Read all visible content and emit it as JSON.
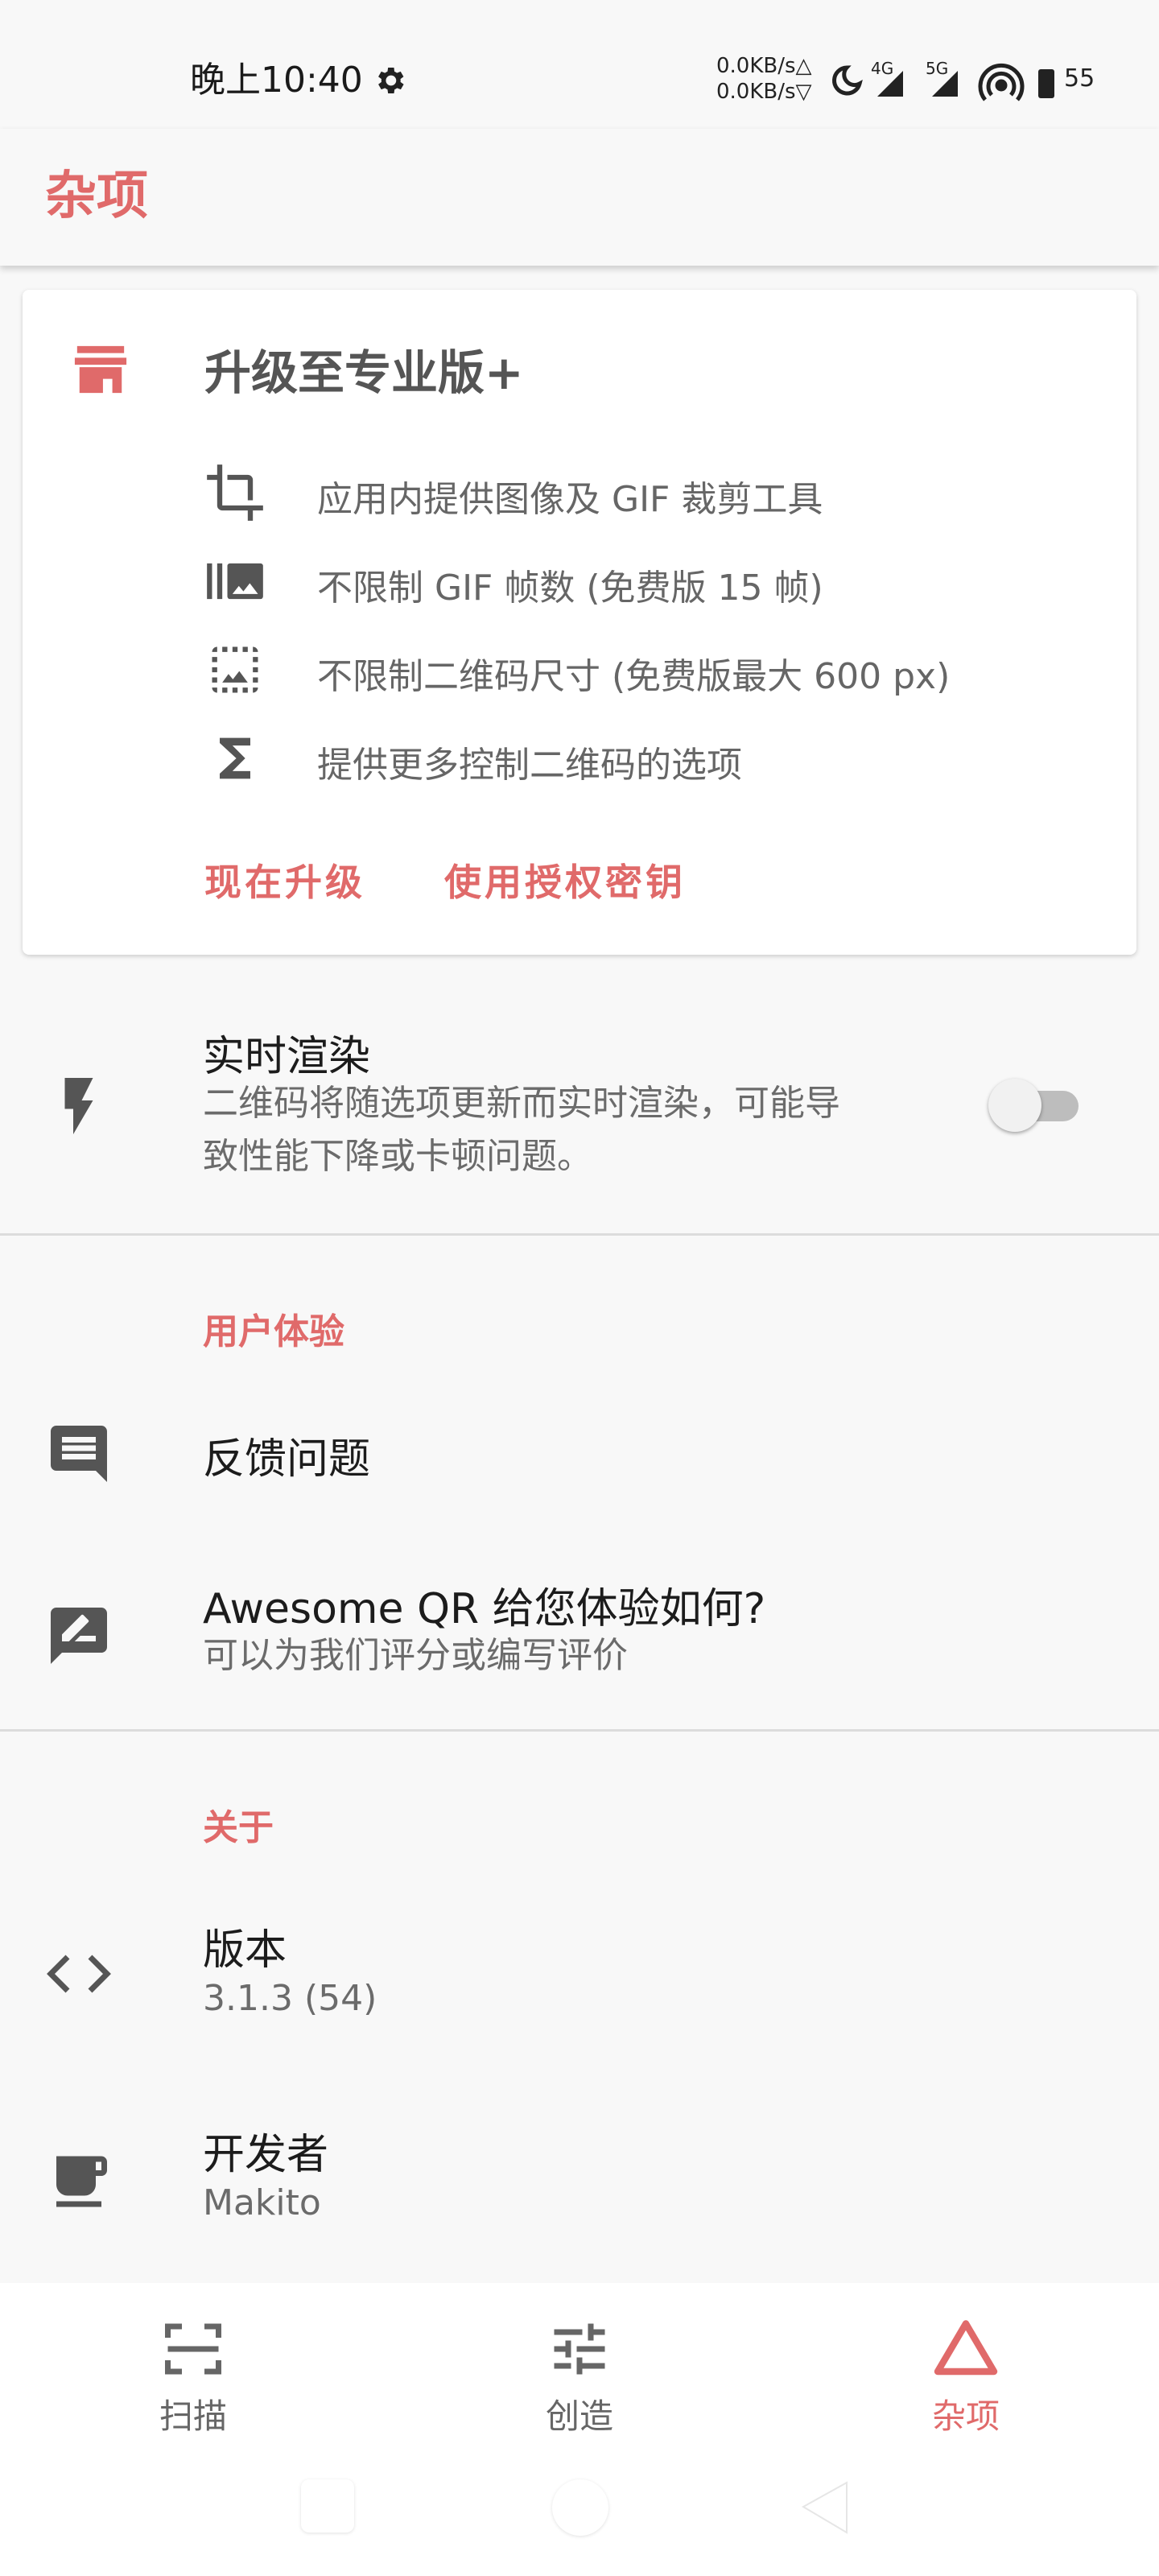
{
  "status_bar": {
    "time": "晚上10:40",
    "net_up": "0.0KB/s△",
    "net_down": "0.0KB/s▽",
    "signal_4g": "4G",
    "signal_5g": "5G",
    "battery": "55"
  },
  "app_bar": {
    "title": "杂项"
  },
  "pro_card": {
    "title": "升级至专业版+",
    "features": [
      {
        "icon": "crop-icon",
        "text": "应用内提供图像及 GIF 裁剪工具"
      },
      {
        "icon": "gif-frames-icon",
        "text": "不限制 GIF 帧数 (免费版 15 帧)"
      },
      {
        "icon": "image-size-icon",
        "text": "不限制二维码尺寸 (免费版最大 600 px)"
      },
      {
        "icon": "sigma-icon",
        "text": "提供更多控制二维码的选项"
      }
    ],
    "upgrade_label": "现在升级",
    "license_label": "使用授权密钥"
  },
  "realtime": {
    "title": "实时渲染",
    "desc_line1": "二维码将随选项更新而实时渲染，可能导",
    "desc_line2": "致性能下降或卡顿问题。",
    "enabled": false
  },
  "ux_section": {
    "header": "用户体验",
    "feedback_title": "反馈问题",
    "rate_title": "Awesome QR 给您体验如何?",
    "rate_sub": "可以为我们评分或编写评价"
  },
  "about_section": {
    "header": "关于",
    "version_title": "版本",
    "version_value": "3.1.3 (54)",
    "developer_title": "开发者",
    "developer_value": "Makito"
  },
  "bottom_nav": {
    "items": [
      {
        "label": "扫描",
        "icon": "scan-icon",
        "active": false
      },
      {
        "label": "创造",
        "icon": "tune-icon",
        "active": false
      },
      {
        "label": "杂项",
        "icon": "triangle-icon",
        "active": true
      }
    ]
  },
  "colors": {
    "accent": "#e06a6a",
    "icon_gray": "#555555"
  }
}
